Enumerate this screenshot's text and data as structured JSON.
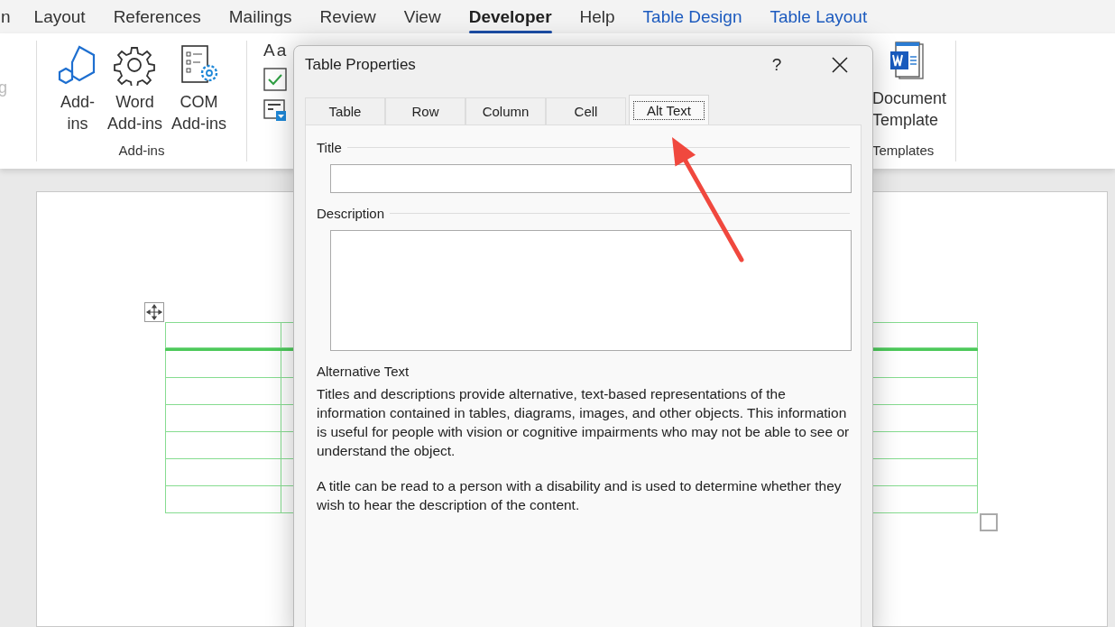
{
  "ribbon_tabs": [
    {
      "label": "n",
      "selected": false,
      "kind": "normal"
    },
    {
      "label": "Layout",
      "selected": false,
      "kind": "normal"
    },
    {
      "label": "References",
      "selected": false,
      "kind": "normal"
    },
    {
      "label": "Mailings",
      "selected": false,
      "kind": "normal"
    },
    {
      "label": "Review",
      "selected": false,
      "kind": "normal"
    },
    {
      "label": "View",
      "selected": false,
      "kind": "normal"
    },
    {
      "label": "Developer",
      "selected": true,
      "kind": "normal"
    },
    {
      "label": "Help",
      "selected": false,
      "kind": "normal"
    },
    {
      "label": "Table Design",
      "selected": false,
      "kind": "contextual"
    },
    {
      "label": "Table Layout",
      "selected": false,
      "kind": "contextual"
    }
  ],
  "ribbon": {
    "left_fragment": "g",
    "addins_group": {
      "label": "Add-ins",
      "buttons": [
        {
          "kind": "hexagons",
          "lines": [
            "Add-",
            "ins"
          ]
        },
        {
          "kind": "gear",
          "lines": [
            "Word",
            "Add-ins"
          ]
        },
        {
          "kind": "com",
          "lines": [
            "COM",
            "Add-ins"
          ]
        }
      ]
    },
    "controls_group": {
      "text": "Aa"
    },
    "templates_group": {
      "button_lines": [
        "Document",
        "Template"
      ],
      "label": "Templates"
    }
  },
  "dialog": {
    "title": "Table Properties",
    "help": "?",
    "tabs": [
      {
        "label": "Table",
        "selected": false
      },
      {
        "label": "Row",
        "selected": false
      },
      {
        "label": "Column",
        "selected": false
      },
      {
        "label": "Cell",
        "selected": false
      },
      {
        "label": "Alt Text",
        "selected": true
      }
    ],
    "title_field": {
      "label": "Title"
    },
    "description_field": {
      "label": "Description"
    },
    "section_title": "Alternative Text",
    "paragraphs": [
      "Titles and descriptions provide alternative, text-based representations of the information contained in tables, diagrams, images, and other objects. This information is useful for people with vision or cognitive impairments who may not be able to see or understand the object.",
      "A title can be read to a person with a disability and is used to determine whether they wish to hear the description of the content."
    ]
  }
}
